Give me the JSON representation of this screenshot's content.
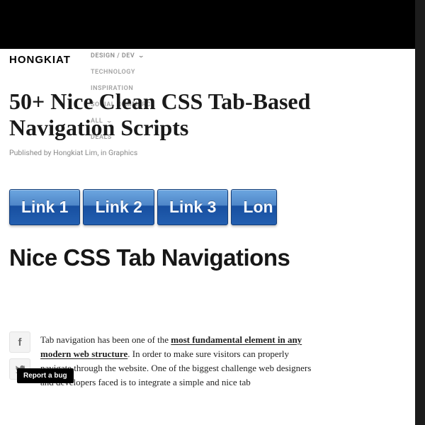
{
  "brand": {
    "logo": "HONGKIAT"
  },
  "nav": {
    "items": [
      {
        "label": "DESIGN / DEV"
      },
      {
        "label": "TECHNOLOGY"
      },
      {
        "label": "INSPIRATION"
      },
      {
        "label": "SOCIAL COMMERCE"
      },
      {
        "label": "ALL"
      },
      {
        "label": "DEALS"
      }
    ]
  },
  "article": {
    "title": "50+ Nice Clean CSS Tab-Based Navigation Scripts",
    "meta_prefix": "Published by ",
    "author": "Hongkiat Lim",
    "meta_in": ", in ",
    "category": "Graphics"
  },
  "hero": {
    "tabs": [
      "Link 1",
      "Link 2",
      "Link 3",
      "Lon"
    ],
    "caption": "Nice CSS Tab Navigations"
  },
  "share": {
    "facebook_glyph": "f",
    "twitter_label": "twitter"
  },
  "body": {
    "p1_a": "Tab navigation has been one of the ",
    "p1_b_strong": "most fundamental element in any modern web structure",
    "p1_c": ". In order to make sure visitors can properly navigate through the website. One of the biggest challenge web designers and developers faced is to integrate a simple and nice tab"
  },
  "bug_button": "Report a bug"
}
